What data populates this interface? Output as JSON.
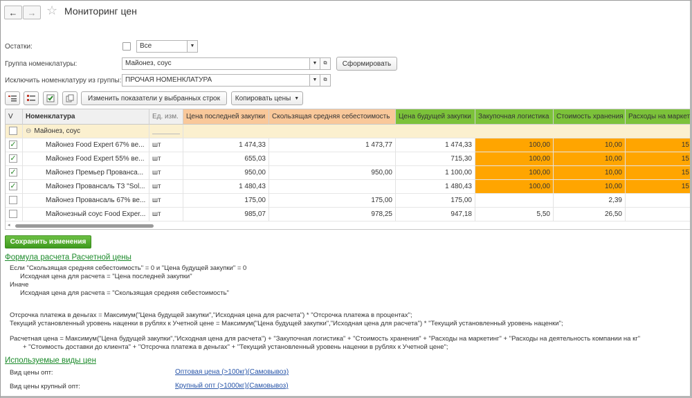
{
  "window": {
    "title": "Мониторинг цен",
    "back_icon": "←",
    "forward_icon": "→",
    "star_icon": "☆"
  },
  "filters": {
    "ostatki_label": "Остатки:",
    "ostatki_value": "Все",
    "group_label": "Группа номенклатуры:",
    "group_value": "Майонез, соус",
    "exclude_label": "Исключить номенклатуру из группы:",
    "exclude_value": "ПРОЧАЯ НОМЕНКЛАТУРА",
    "form_button": "Сформировать"
  },
  "toolbar": {
    "change_button": "Изменить показатели у выбранных строк",
    "copy_button": "Копировать цены"
  },
  "table": {
    "headers": [
      "V",
      "Номенклатура",
      "Ед. изм.",
      "Цена последней закупки",
      "Скользящая средняя себестоимость",
      "Цена будущей закупки",
      "Закупочная логистика",
      "Стоимость хранения",
      "Расходы на маркетинг"
    ],
    "header_colors": [
      "#f0f0f0",
      "#f0f0f0",
      "#f0f0f0",
      "#f9c89a",
      "#f9c89a",
      "#7cc23a",
      "#7cc23a",
      "#7cc23a",
      "#7cc23a"
    ],
    "group_row": "Майонез, соус",
    "rows": [
      {
        "checked": true,
        "name": "Майонез Food Expert 67% ве...",
        "unit": "шт",
        "last": "1 474,33",
        "avg": "1 473,77",
        "future": "1 474,33",
        "log": "100,00",
        "store": "10,00",
        "mkt": "15",
        "orange": true
      },
      {
        "checked": true,
        "name": "Майонез Food Expert 55% ве...",
        "unit": "шт",
        "last": "655,03",
        "avg": "",
        "future": "715,30",
        "log": "100,00",
        "store": "10,00",
        "mkt": "15",
        "orange": true
      },
      {
        "checked": true,
        "name": "Майонез Премьер  Прованса...",
        "unit": "шт",
        "last": "950,00",
        "avg": "950,00",
        "future": "1 100,00",
        "log": "100,00",
        "store": "10,00",
        "mkt": "15",
        "orange": true
      },
      {
        "checked": true,
        "name": "Майонез Провансаль ТЗ \"Sol...",
        "unit": "шт",
        "last": "1 480,43",
        "avg": "",
        "future": "1 480,43",
        "log": "100,00",
        "store": "10,00",
        "mkt": "15",
        "orange": true
      },
      {
        "checked": false,
        "name": "Майонез Провансаль 67% ве...",
        "unit": "шт",
        "last": "175,00",
        "avg": "175,00",
        "future": "175,00",
        "log": "",
        "store": "2,39",
        "mkt": "",
        "orange": false
      },
      {
        "checked": false,
        "name": "Майонезный соус Food Exper...",
        "unit": "шт",
        "last": "985,07",
        "avg": "978,25",
        "future": "947,18",
        "log": "5,50",
        "store": "26,50",
        "mkt": "",
        "orange": false
      }
    ]
  },
  "save_button": "Сохранить изменения",
  "formula": {
    "heading": "Формула расчета Расчетной цены",
    "lines": [
      "Если \"Скользящая средняя себестоимость\" = 0 и \"Цена будущей закупки\" = 0",
      "Исходная цена для расчета =  \"Цена последней закупки\"",
      "Иначе",
      "Исходная цена для расчета = \"Скользящая средняя себестоимость\"",
      "Отсрочка платежа в деньгах =  Максимум(\"Цена будущей закупки\",\"Исходная цена для расчета\")  * \"Отсрочка платежа в процентах\";",
      "Текущий установленный уровень наценки в рублях к Учетной цене = Максимум(\"Цена будущей закупки\",\"Исходная цена для расчета\")  * \"Текущий установленный уровень наценки\";",
      "Расчетная цена = Максимум(\"Цена будущей закупки\",\"Исходная цена для расчета\") + \"Закупочная логистика\" + \"Стоимость хранения\" + \"Расходы на маркетинг\" + \"Расходы на деятельность компании на кг\"",
      "+ \"Стоимость доставки до клиента\" + \"Отсрочка платежа в деньгах\" + \"Текущий установленный уровень наценки в рублях к Учетной цене\";"
    ]
  },
  "price_types": {
    "heading": "Используемые виды цен",
    "opt_label": "Вид цены опт:",
    "opt_value": "Оптовая цена (>100кг)(Самовывоз)",
    "big_label": "Вид цены крупный опт:",
    "big_value": "Крупный опт (>1000кг)(Самовывоз)"
  },
  "colors": {
    "accent_green": "#3f9a1e",
    "header_orange": "#f9c89a",
    "header_green": "#7cc23a",
    "cell_orange": "#ffa500",
    "group_row": "#fbf0cf"
  }
}
